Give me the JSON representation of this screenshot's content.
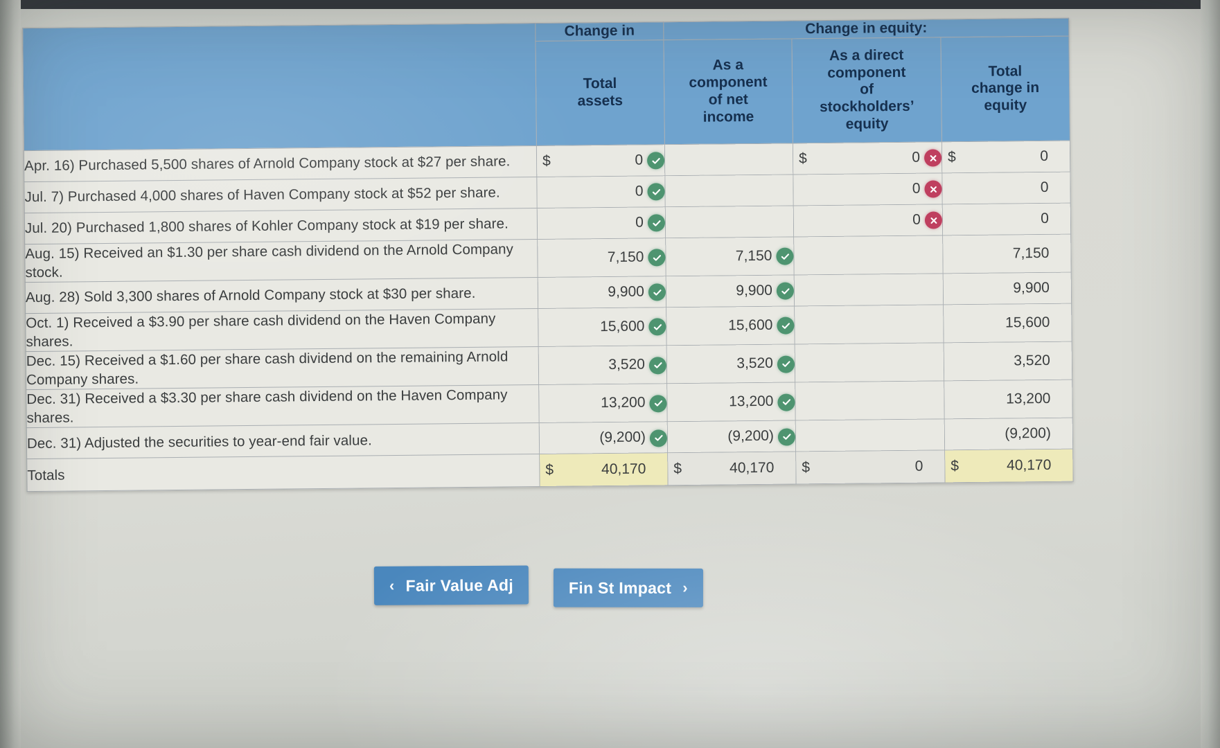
{
  "table": {
    "header": {
      "group_change_in": "Change in",
      "group_change_in_equity": "Change in equity:",
      "col_total_assets": "Total\nassets",
      "col_net_income": "As a\ncomponent\nof net\nincome",
      "col_direct_equity": "As a direct\ncomponent\nof\nstockholders’\nequity",
      "col_total_equity": "Total\nchange in\nequity"
    },
    "rows": [
      {
        "description": "Apr. 16)  Purchased 5,500 shares of Arnold Company stock at $27 per share.",
        "total_assets": {
          "dollar": "$",
          "value": "0",
          "mark": "correct"
        },
        "net_income": {
          "dollar": "",
          "value": "",
          "mark": "none"
        },
        "direct_equity": {
          "dollar": "$",
          "value": "0",
          "mark": "wrong"
        },
        "total_equity": {
          "dollar": "$",
          "value": "0",
          "mark": "none"
        }
      },
      {
        "description": "Jul. 7)  Purchased 4,000 shares of Haven Company stock at $52 per share.",
        "total_assets": {
          "dollar": "",
          "value": "0",
          "mark": "correct"
        },
        "net_income": {
          "dollar": "",
          "value": "",
          "mark": "none"
        },
        "direct_equity": {
          "dollar": "",
          "value": "0",
          "mark": "wrong"
        },
        "total_equity": {
          "dollar": "",
          "value": "0",
          "mark": "none"
        }
      },
      {
        "description": "Jul. 20)  Purchased 1,800 shares of Kohler Company stock at $19 per share.",
        "total_assets": {
          "dollar": "",
          "value": "0",
          "mark": "correct"
        },
        "net_income": {
          "dollar": "",
          "value": "",
          "mark": "none"
        },
        "direct_equity": {
          "dollar": "",
          "value": "0",
          "mark": "wrong"
        },
        "total_equity": {
          "dollar": "",
          "value": "0",
          "mark": "none"
        }
      },
      {
        "description": "Aug. 15)  Received an $1.30 per share cash dividend on the Arnold Company stock.",
        "total_assets": {
          "dollar": "",
          "value": "7,150",
          "mark": "correct"
        },
        "net_income": {
          "dollar": "",
          "value": "7,150",
          "mark": "correct"
        },
        "direct_equity": {
          "dollar": "",
          "value": "",
          "mark": "none"
        },
        "total_equity": {
          "dollar": "",
          "value": "7,150",
          "mark": "none"
        }
      },
      {
        "description": "Aug. 28)  Sold 3,300 shares of Arnold Company stock at $30 per share.",
        "total_assets": {
          "dollar": "",
          "value": "9,900",
          "mark": "correct"
        },
        "net_income": {
          "dollar": "",
          "value": "9,900",
          "mark": "correct"
        },
        "direct_equity": {
          "dollar": "",
          "value": "",
          "mark": "none"
        },
        "total_equity": {
          "dollar": "",
          "value": "9,900",
          "mark": "none"
        }
      },
      {
        "description": "Oct. 1)  Received a $3.90 per share cash dividend on the Haven Company shares.",
        "total_assets": {
          "dollar": "",
          "value": "15,600",
          "mark": "correct"
        },
        "net_income": {
          "dollar": "",
          "value": "15,600",
          "mark": "correct"
        },
        "direct_equity": {
          "dollar": "",
          "value": "",
          "mark": "none"
        },
        "total_equity": {
          "dollar": "",
          "value": "15,600",
          "mark": "none"
        }
      },
      {
        "description": "Dec. 15)  Received a $1.60 per share cash dividend on the remaining Arnold Company shares.",
        "total_assets": {
          "dollar": "",
          "value": "3,520",
          "mark": "correct"
        },
        "net_income": {
          "dollar": "",
          "value": "3,520",
          "mark": "correct"
        },
        "direct_equity": {
          "dollar": "",
          "value": "",
          "mark": "none"
        },
        "total_equity": {
          "dollar": "",
          "value": "3,520",
          "mark": "none"
        }
      },
      {
        "description": "Dec. 31)  Received a $3.30 per share cash dividend on the Haven Company shares.",
        "total_assets": {
          "dollar": "",
          "value": "13,200",
          "mark": "correct"
        },
        "net_income": {
          "dollar": "",
          "value": "13,200",
          "mark": "correct"
        },
        "direct_equity": {
          "dollar": "",
          "value": "",
          "mark": "none"
        },
        "total_equity": {
          "dollar": "",
          "value": "13,200",
          "mark": "none"
        }
      },
      {
        "description": "Dec. 31)  Adjusted the securities to year-end fair value.",
        "total_assets": {
          "dollar": "",
          "value": "(9,200)",
          "mark": "correct"
        },
        "net_income": {
          "dollar": "",
          "value": "(9,200)",
          "mark": "correct"
        },
        "direct_equity": {
          "dollar": "",
          "value": "",
          "mark": "none"
        },
        "total_equity": {
          "dollar": "",
          "value": "(9,200)",
          "mark": "none"
        }
      }
    ],
    "totals": {
      "label": "Totals",
      "total_assets": {
        "dollar": "$",
        "value": "40,170"
      },
      "net_income": {
        "dollar": "$",
        "value": "40,170"
      },
      "direct_equity": {
        "dollar": "$",
        "value": "0"
      },
      "total_equity": {
        "dollar": "$",
        "value": "40,170"
      }
    }
  },
  "nav": {
    "prev_label": "Fair Value Adj",
    "prev_chevron": "‹",
    "next_label": "Fin St Impact",
    "next_chevron": "›"
  },
  "colors": {
    "header_blue": "#6fa3ce",
    "button_blue": "#4a87bd",
    "correct_green": "#4e9470",
    "wrong_red": "#bf3f5f",
    "total_highlight": "#eeeaba"
  }
}
